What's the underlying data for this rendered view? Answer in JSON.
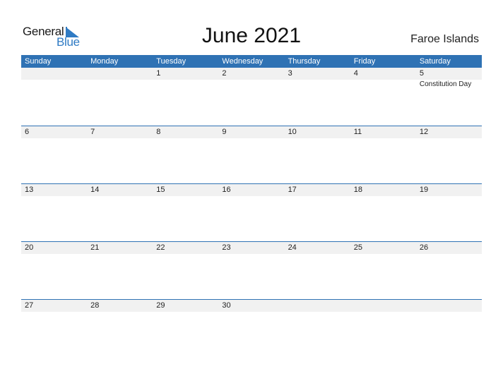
{
  "logo": {
    "line1": "General",
    "line2": "Blue"
  },
  "title": "June 2021",
  "country": "Faroe Islands",
  "colors": {
    "accent": "#2f72b4",
    "strip": "#f1f1f1"
  },
  "weekdays": [
    "Sunday",
    "Monday",
    "Tuesday",
    "Wednesday",
    "Thursday",
    "Friday",
    "Saturday"
  ],
  "weeks": [
    {
      "days": [
        "",
        "",
        "1",
        "2",
        "3",
        "4",
        "5"
      ],
      "events": [
        "",
        "",
        "",
        "",
        "",
        "",
        "Constitution Day"
      ]
    },
    {
      "days": [
        "6",
        "7",
        "8",
        "9",
        "10",
        "11",
        "12"
      ],
      "events": [
        "",
        "",
        "",
        "",
        "",
        "",
        ""
      ]
    },
    {
      "days": [
        "13",
        "14",
        "15",
        "16",
        "17",
        "18",
        "19"
      ],
      "events": [
        "",
        "",
        "",
        "",
        "",
        "",
        ""
      ]
    },
    {
      "days": [
        "20",
        "21",
        "22",
        "23",
        "24",
        "25",
        "26"
      ],
      "events": [
        "",
        "",
        "",
        "",
        "",
        "",
        ""
      ]
    },
    {
      "days": [
        "27",
        "28",
        "29",
        "30",
        "",
        "",
        ""
      ],
      "events": [
        "",
        "",
        "",
        "",
        "",
        "",
        ""
      ]
    }
  ]
}
